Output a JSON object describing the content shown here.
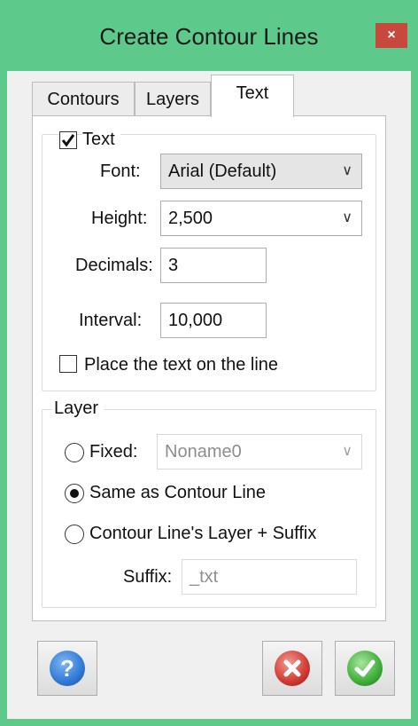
{
  "window": {
    "title": "Create Contour Lines",
    "close_glyph": "×"
  },
  "tabs": [
    {
      "label": "Contours"
    },
    {
      "label": "Layers"
    },
    {
      "label": "Text",
      "active": true
    }
  ],
  "text_group": {
    "checkbox_label": "Text",
    "checked": true,
    "font": {
      "label": "Font:",
      "value": "Arial (Default)"
    },
    "height": {
      "label": "Height:",
      "value": "2,500"
    },
    "decimals": {
      "label": "Decimals:",
      "value": "3"
    },
    "interval": {
      "label": "Interval:",
      "value": "10,000"
    },
    "place_on_line": {
      "label": "Place the text on the line",
      "checked": false
    }
  },
  "layer_group": {
    "legend": "Layer",
    "fixed": {
      "label": "Fixed:",
      "value": "Noname0",
      "selected": false
    },
    "same_as_contour": {
      "label": "Same as Contour Line",
      "selected": true
    },
    "layer_suffix": {
      "label": "Contour Line's Layer + Suffix",
      "selected": false
    },
    "suffix": {
      "label": "Suffix:",
      "value": "_txt"
    }
  },
  "buttons": {
    "help_icon": "question-icon",
    "cancel_icon": "cancel-icon",
    "ok_icon": "ok-check-icon"
  },
  "colors": {
    "frame": "#5dc98a",
    "close": "#c7483c",
    "help": "#2f7ad6",
    "cancel": "#d03a32",
    "ok": "#3fae3a"
  }
}
